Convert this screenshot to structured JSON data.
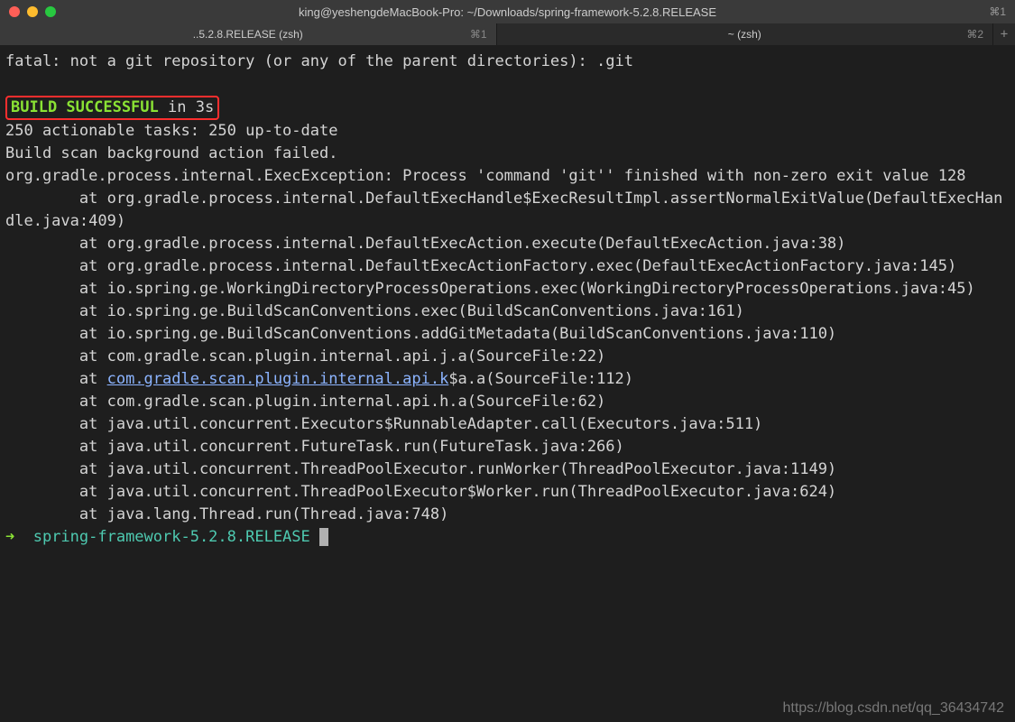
{
  "window": {
    "title": "king@yeshengdeMacBook-Pro: ~/Downloads/spring-framework-5.2.8.RELEASE",
    "shortcut_hint": "⌘1"
  },
  "tabs": {
    "left": {
      "label": "..5.2.8.RELEASE (zsh)",
      "shortcut": "⌘1"
    },
    "right": {
      "label": "~ (zsh)",
      "shortcut": "⌘2"
    }
  },
  "output": {
    "line_fatal": "fatal: not a git repository (or any of the parent directories): .git",
    "build_success": "BUILD SUCCESSFUL",
    "build_suffix": " in 3s",
    "tasks": "250 actionable tasks: 250 up-to-date",
    "scan_failed": "Build scan background action failed.",
    "exec_exception": "org.gradle.process.internal.ExecException: Process 'command 'git'' finished with non-zero exit value 128",
    "stack": [
      "org.gradle.process.internal.DefaultExecHandle$ExecResultImpl.assertNormalExitValue(DefaultExecHandle.java:409)",
      "org.gradle.process.internal.DefaultExecAction.execute(DefaultExecAction.java:38)",
      "org.gradle.process.internal.DefaultExecActionFactory.exec(DefaultExecActionFactory.java:145)",
      "io.spring.ge.WorkingDirectoryProcessOperations.exec(WorkingDirectoryProcessOperations.java:45)",
      "io.spring.ge.BuildScanConventions.exec(BuildScanConventions.java:161)",
      "io.spring.ge.BuildScanConventions.addGitMetadata(BuildScanConventions.java:110)",
      "com.gradle.scan.plugin.internal.api.j.a(SourceFile:22)"
    ],
    "stack_link_prefix": "com.gradle.scan.plugin.internal.api.k",
    "stack_link_suffix": "$a.a(SourceFile:112)",
    "stack_after": [
      "com.gradle.scan.plugin.internal.api.h.a(SourceFile:62)",
      "java.util.concurrent.Executors$RunnableAdapter.call(Executors.java:511)",
      "java.util.concurrent.FutureTask.run(FutureTask.java:266)",
      "java.util.concurrent.ThreadPoolExecutor.runWorker(ThreadPoolExecutor.java:1149)",
      "java.util.concurrent.ThreadPoolExecutor$Worker.run(ThreadPoolExecutor.java:624)",
      "java.lang.Thread.run(Thread.java:748)"
    ]
  },
  "prompt": {
    "arrow": "➜  ",
    "path": "spring-framework-5.2.8.RELEASE "
  },
  "watermark": "https://blog.csdn.net/qq_36434742"
}
